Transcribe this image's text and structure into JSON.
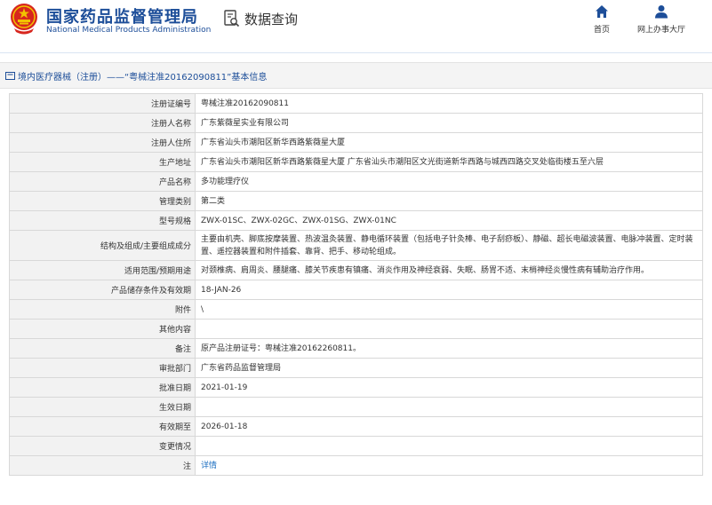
{
  "site": {
    "title_cn": "国家药品监督管理局",
    "title_en": "National Medical Products Administration",
    "section": "数据查询",
    "emblem_icon": "national-emblem-icon",
    "query_icon": "document-search-icon"
  },
  "nav": {
    "home": "首页",
    "hall": "网上办事大厅",
    "home_icon": "home-icon",
    "hall_icon": "person-icon"
  },
  "title": {
    "text": "境内医疗器械（注册）——“粤械注准20162090811”基本信息",
    "icon": "folder-icon"
  },
  "rows": [
    {
      "label": "注册证编号",
      "value": "粤械注准20162090811"
    },
    {
      "label": "注册人名称",
      "value": "广东紫薇星实业有限公司"
    },
    {
      "label": "注册人住所",
      "value": "广东省汕头市潮阳区新华西路紫薇星大厦"
    },
    {
      "label": "生产地址",
      "value": "广东省汕头市潮阳区新华西路紫薇星大厦 广东省汕头市潮阳区文光街道新华西路与城西四路交叉处临街楼五至六层"
    },
    {
      "label": "产品名称",
      "value": "多功能理疗仪"
    },
    {
      "label": "管理类别",
      "value": "第二类"
    },
    {
      "label": "型号规格",
      "value": "ZWX-01SC、ZWX-02GC、ZWX-01SG、ZWX-01NC"
    },
    {
      "label": "结构及组成/主要组成成分",
      "value": "主要由机壳、脚底按摩装置、热波温灸装置、静电循环装置（包括电子针灸棒、电子刮痧板）、静磁、超长电磁波装置、电脉冲装置、定时装置、遥控器装置和附件插套、靠背、把手、移动轮组成。"
    },
    {
      "label": "适用范围/预期用途",
      "value": "对颈椎病、肩周炎、腰腿痛、膝关节疾患有镇痛、消炎作用及神经衰弱、失眠、肠胃不适、末梢神经炎慢性病有辅助治疗作用。"
    },
    {
      "label": "产品储存条件及有效期",
      "value": "18-JAN-26"
    },
    {
      "label": "附件",
      "value": "\\"
    },
    {
      "label": "其他内容",
      "value": ""
    },
    {
      "label": "备注",
      "value": "原产品注册证号：粤械注准20162260811。"
    },
    {
      "label": "审批部门",
      "value": "广东省药品监督管理局"
    },
    {
      "label": "批准日期",
      "value": "2021-01-19"
    },
    {
      "label": "生效日期",
      "value": ""
    },
    {
      "label": "有效期至",
      "value": "2026-01-18"
    },
    {
      "label": "变更情况",
      "value": ""
    },
    {
      "label": "注",
      "value": "详情",
      "link": true
    }
  ],
  "colors": {
    "brand_blue": "#1d4e99",
    "link_blue": "#1d6fc1",
    "emblem_red": "#d7261e",
    "emblem_gold": "#f2c300"
  }
}
